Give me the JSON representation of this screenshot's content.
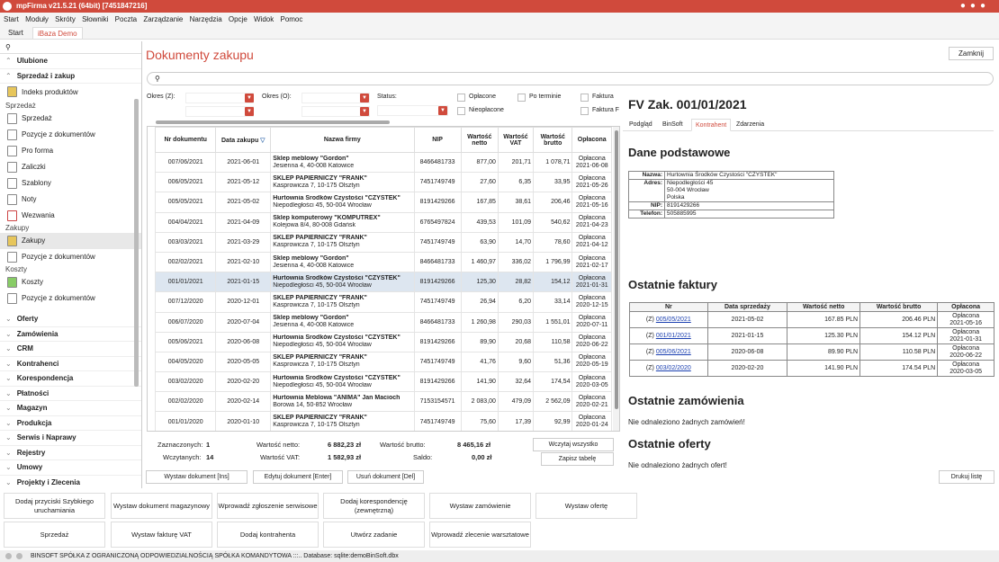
{
  "window": {
    "title": "mpFirma v21.5.21 (64bit) [7451847216]"
  },
  "menu": [
    "Start",
    "Moduły",
    "Skróty",
    "Słowniki",
    "Poczta",
    "Zarządzanie",
    "Narzędzia",
    "Opcje",
    "Widok",
    "Pomoc"
  ],
  "tabs": [
    "Start",
    "iBaza Demo"
  ],
  "sidebar": {
    "search_icon": "search-icon",
    "sections_top": [
      "Ulubione",
      "Sprzedaż i zakup"
    ],
    "fav_item": "Indeks produktów",
    "group_sprzedaz": "Sprzedaż",
    "items_sprzedaz": [
      "Sprzedaż",
      "Pozycje z dokumentów",
      "Pro forma",
      "Zaliczki",
      "Szablony",
      "Noty",
      "Wezwania"
    ],
    "group_zakupy": "Zakupy",
    "items_zakupy": [
      "Zakupy",
      "Pozycje z dokumentów"
    ],
    "group_koszty": "Koszty",
    "items_koszty": [
      "Koszty",
      "Pozycje z dokumentów"
    ],
    "sections_bottom": [
      "Oferty",
      "Zamówienia",
      "CRM",
      "Kontrahenci",
      "Korespondencja",
      "Płatności",
      "Magazyn",
      "Produkcja",
      "Serwis i Naprawy",
      "Rejestry",
      "Umowy",
      "Projekty i Zlecenia"
    ]
  },
  "main": {
    "title": "Dokumenty zakupu",
    "close": "Zamknij",
    "filters": {
      "okres_z": "Okres (Z):",
      "okres_o": "Okres (O):",
      "status": "Status:",
      "oplacone": "Opłacone",
      "nieoplacone": "Nieopłacone",
      "po_terminie": "Po terminie",
      "faktura1": "Faktura",
      "faktura2": "Faktura F"
    },
    "columns": [
      "Nr dokumentu",
      "Data zakupu",
      "Nazwa firmy",
      "NIP",
      "Wartość netto",
      "Wartość VAT",
      "Wartość brutto",
      "Opłacona"
    ],
    "rows": [
      [
        "007/06/2021",
        "2021-06-01",
        "Sklep meblowy \"Gordon\"",
        "Jesienna 4, 40-008 Katowice",
        "8466481733",
        "877,00",
        "201,71",
        "1 078,71",
        "Opłacona",
        "2021-06-08"
      ],
      [
        "006/05/2021",
        "2021-05-12",
        "SKLEP PAPIERNICZY \"FRANK\"",
        "Kasprowicza 7, 10-175 Olsztyn",
        "7451749749",
        "27,60",
        "6,35",
        "33,95",
        "Opłacona",
        "2021-05-26"
      ],
      [
        "005/05/2021",
        "2021-05-02",
        "Hurtownia Środków Czystości \"CZYSTEK\"",
        "Niepodległości 45, 50-004 Wrocław",
        "8191429266",
        "167,85",
        "38,61",
        "206,46",
        "Opłacona",
        "2021-05-16"
      ],
      [
        "004/04/2021",
        "2021-04-09",
        "Sklep komputerowy \"KOMPUTREX\"",
        "Kolejowa 8/4, 80-008 Gdańsk",
        "6765497824",
        "439,53",
        "101,09",
        "540,62",
        "Opłacona",
        "2021-04-23"
      ],
      [
        "003/03/2021",
        "2021-03-29",
        "SKLEP PAPIERNICZY \"FRANK\"",
        "Kasprowicza 7, 10-175 Olsztyn",
        "7451749749",
        "63,90",
        "14,70",
        "78,60",
        "Opłacona",
        "2021-04-12"
      ],
      [
        "002/02/2021",
        "2021-02-10",
        "Sklep meblowy \"Gordon\"",
        "Jesienna 4, 40-008 Katowice",
        "8466481733",
        "1 460,97",
        "336,02",
        "1 796,99",
        "Opłacona",
        "2021-02-17"
      ],
      [
        "001/01/2021",
        "2021-01-15",
        "Hurtownia Środków Czystości \"CZYSTEK\"",
        "Niepodległości 45, 50-004 Wrocław",
        "8191429266",
        "125,30",
        "28,82",
        "154,12",
        "Opłacona",
        "2021-01-31"
      ],
      [
        "007/12/2020",
        "2020-12-01",
        "SKLEP PAPIERNICZY \"FRANK\"",
        "Kasprowicza 7, 10-175 Olsztyn",
        "7451749749",
        "26,94",
        "6,20",
        "33,14",
        "Opłacona",
        "2020-12-15"
      ],
      [
        "006/07/2020",
        "2020-07-04",
        "Sklep meblowy \"Gordon\"",
        "Jesienna 4, 40-008 Katowice",
        "8466481733",
        "1 260,98",
        "290,03",
        "1 551,01",
        "Opłacona",
        "2020-07-11"
      ],
      [
        "005/06/2021",
        "2020-06-08",
        "Hurtownia Środków Czystości \"CZYSTEK\"",
        "Niepodległości 45, 50-004 Wrocław",
        "8191429266",
        "89,90",
        "20,68",
        "110,58",
        "Opłacona",
        "2020-06-22"
      ],
      [
        "004/05/2020",
        "2020-05-05",
        "SKLEP PAPIERNICZY \"FRANK\"",
        "Kasprowicza 7, 10-175 Olsztyn",
        "7451749749",
        "41,76",
        "9,60",
        "51,36",
        "Opłacona",
        "2020-05-19"
      ],
      [
        "003/02/2020",
        "2020-02-20",
        "Hurtownia Środków Czystości \"CZYSTEK\"",
        "Niepodległości 45, 50-004 Wrocław",
        "8191429266",
        "141,90",
        "32,64",
        "174,54",
        "Opłacona",
        "2020-03-05"
      ],
      [
        "002/02/2020",
        "2020-02-14",
        "Hurtownia Meblowa \"ANIMA\" Jan Macioch",
        "Borowa 14, 50-852 Wrocław",
        "7153154571",
        "2 083,00",
        "479,09",
        "2 562,09",
        "Opłacona",
        "2020-02-21"
      ],
      [
        "001/01/2020",
        "2020-01-10",
        "SKLEP PAPIERNICZY \"FRANK\"",
        "Kasprowicza 7, 10-175 Olsztyn",
        "7451749749",
        "75,60",
        "17,39",
        "92,99",
        "Opłacona",
        "2020-01-24"
      ]
    ],
    "selected_row": 6,
    "summary": {
      "zazn_l": "Zaznaczonych:",
      "zazn_v": "1",
      "wczyt_l": "Wczytanych:",
      "wczyt_v": "14",
      "netto_l": "Wartość netto:",
      "netto_v": "6 882,23 zł",
      "vat_l": "Wartość VAT:",
      "vat_v": "1 582,93 zł",
      "brutto_l": "Wartość brutto:",
      "brutto_v": "8 465,16 zł",
      "saldo_l": "Saldo:",
      "saldo_v": "0,00 zł",
      "load_all": "Wczytaj wszystko",
      "save_table": "Zapisz tabelę"
    },
    "actions": {
      "issue": "Wystaw dokument [Ins]",
      "edit": "Edytuj dokument [Enter]",
      "delete": "Usuń dokument [Del]",
      "print": "Drukuj listę"
    }
  },
  "detail": {
    "title": "FV Zak. 001/01/2021",
    "tabs": [
      "Podgląd",
      "BinSoft",
      "Kontrahent",
      "Zdarzenia"
    ],
    "dane_h": "Dane podstawowe",
    "nazwa_k": "Nazwa:",
    "nazwa_v": "Hurtownia Środków Czystości \"CZYSTEK\"",
    "adres_k": "Adres:",
    "adres_v1": "Niepodległości 45",
    "adres_v2": "50-004 Wrocław",
    "adres_v3": "Polska",
    "nip_k": "NIP:",
    "nip_v": "8191429266",
    "tel_k": "Telefon:",
    "tel_v": "505885995",
    "faktury_h": "Ostatnie faktury",
    "fak_cols": [
      "Nr",
      "Data sprzedaży",
      "Wartość netto",
      "Wartość brutto",
      "Opłacona"
    ],
    "fak_rows": [
      [
        "(Z)",
        "005/05/2021",
        "2021-05-02",
        "167.85 PLN",
        "206.46 PLN",
        "Opłacona",
        "2021-05-16"
      ],
      [
        "(Z)",
        "001/01/2021",
        "2021-01-15",
        "125.30 PLN",
        "154.12 PLN",
        "Opłacona",
        "2021-01-31"
      ],
      [
        "(Z)",
        "005/06/2021",
        "2020-06-08",
        "89.90 PLN",
        "110.58 PLN",
        "Opłacona",
        "2020-06-22"
      ],
      [
        "(Z)",
        "003/02/2020",
        "2020-02-20",
        "141.90 PLN",
        "174.54 PLN",
        "Opłacona",
        "2020-03-05"
      ]
    ],
    "zam_h": "Ostatnie zamówienia",
    "zam_msg": "Nie odnaleziono żadnych zamówień!",
    "ofe_h": "Ostatnie oferty",
    "ofe_msg": "Nie odnaleziono żadnych ofert!"
  },
  "bottom": {
    "row1": [
      "Dodaj przyciski Szybkiego uruchamiania",
      "Wystaw dokument magazynowy",
      "Wprowadź zgłoszenie serwisowe",
      "Dodaj korespondencję (zewnętrzną)",
      "Wystaw zamówienie",
      "Wystaw ofertę"
    ],
    "row2": [
      "Sprzedaż",
      "Wystaw fakturę VAT",
      "Dodaj kontrahenta",
      "Utwórz zadanie",
      "Wprowadź zlecenie warsztatowe"
    ]
  },
  "status": "BINSOFT SPÓŁKA Z OGRANICZONĄ ODPOWIEDZIALNOŚCIĄ SPÓŁKA KOMANDYTOWA :::.. Database: sqlite:demoBinSoft.dbx",
  "colors": {
    "accent": "#d04a3c",
    "selection": "#dde6f0",
    "link": "#1a3fb0"
  }
}
